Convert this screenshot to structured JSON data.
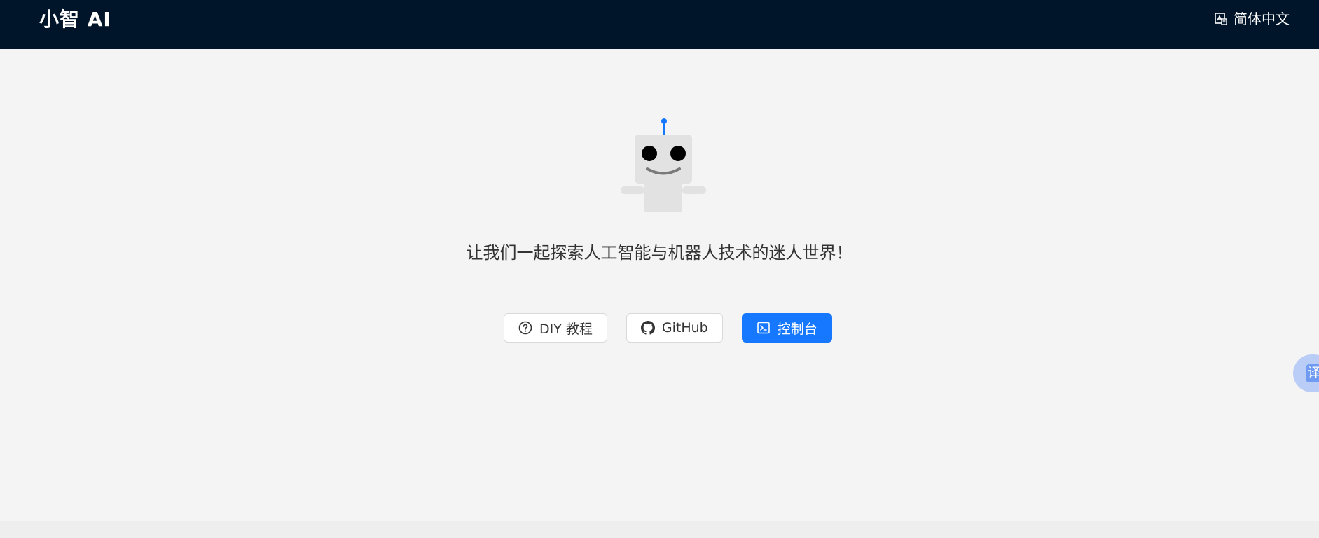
{
  "header": {
    "logo": "小智 AI",
    "language_label": "简体中文"
  },
  "hero": {
    "tagline": "让我们一起探索人工智能与机器人技术的迷人世界！"
  },
  "buttons": {
    "diy_label": "DIY 教程",
    "github_label": "GitHub",
    "console_label": "控制台"
  },
  "floating_translate": {
    "label": "译"
  },
  "colors": {
    "header_bg": "#001529",
    "page_bg": "#f4f4f4",
    "primary": "#1677ff",
    "robot_body": "#e2e2e2",
    "robot_antenna": "#1677ff"
  },
  "icons": {
    "language": "translate-icon",
    "diy": "question-circle-icon",
    "github": "github-icon",
    "console": "terminal-icon"
  }
}
